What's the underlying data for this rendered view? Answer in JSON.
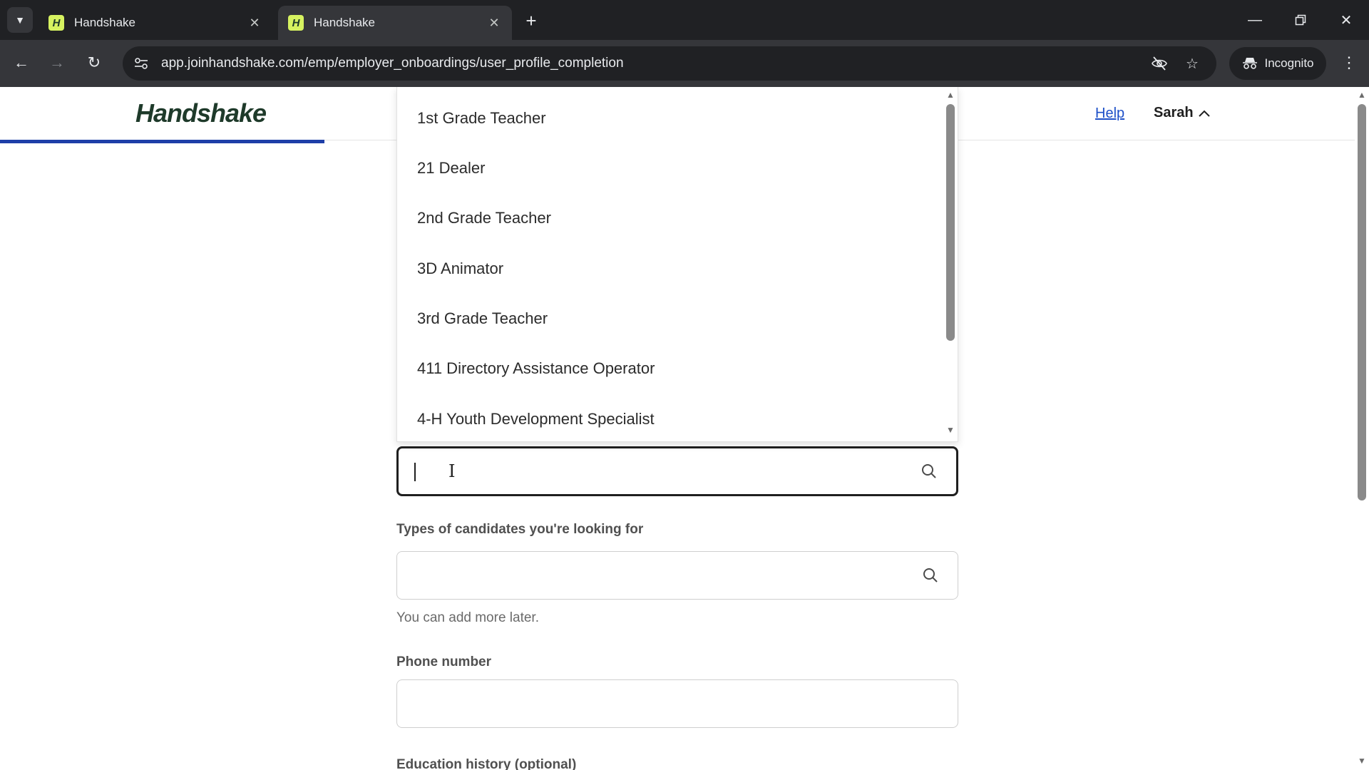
{
  "browser": {
    "tabs": [
      {
        "title": "Handshake",
        "favicon": "H"
      },
      {
        "title": "Handshake",
        "favicon": "H"
      }
    ],
    "url": "app.joinhandshake.com/emp/employer_onboardings/user_profile_completion",
    "incognito_label": "Incognito"
  },
  "header": {
    "logo": "Handshake",
    "help": "Help",
    "user": "Sarah",
    "progress_fraction": 0.237
  },
  "dropdown": {
    "options": [
      "1st Grade Teacher",
      "21 Dealer",
      "2nd Grade Teacher",
      "3D Animator",
      "3rd Grade Teacher",
      "411 Directory Assistance Operator",
      "4-H Youth Development Specialist"
    ]
  },
  "form": {
    "job_title_search": {
      "value": "",
      "placeholder": ""
    },
    "candidates": {
      "label": "Types of candidates you're looking for",
      "value": "",
      "helper": "You can add more later."
    },
    "phone": {
      "label": "Phone number",
      "value": ""
    },
    "education": {
      "label": "Education history (optional)"
    }
  }
}
